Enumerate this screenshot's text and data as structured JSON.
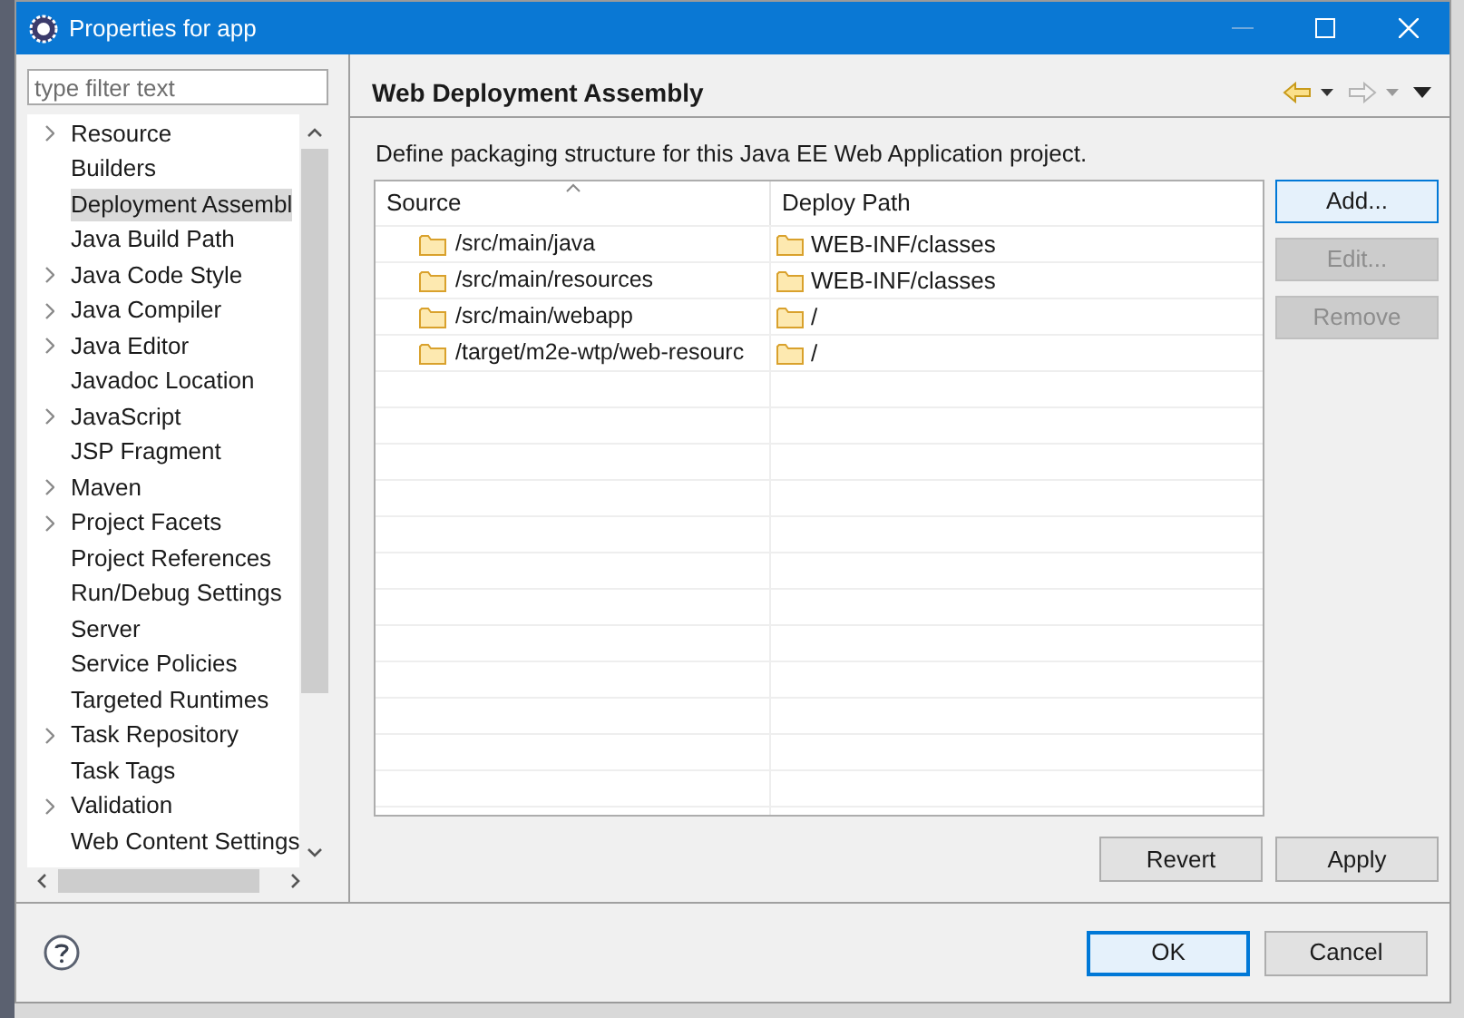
{
  "window": {
    "title": "Properties for app"
  },
  "filter": {
    "placeholder": "type filter text"
  },
  "tree": {
    "items": [
      {
        "label": "Resource",
        "has_children": true,
        "selected": false
      },
      {
        "label": "Builders",
        "has_children": false,
        "selected": false
      },
      {
        "label": "Deployment Assembl",
        "has_children": false,
        "selected": true
      },
      {
        "label": "Java Build Path",
        "has_children": false,
        "selected": false
      },
      {
        "label": "Java Code Style",
        "has_children": true,
        "selected": false
      },
      {
        "label": "Java Compiler",
        "has_children": true,
        "selected": false
      },
      {
        "label": "Java Editor",
        "has_children": true,
        "selected": false
      },
      {
        "label": "Javadoc Location",
        "has_children": false,
        "selected": false
      },
      {
        "label": "JavaScript",
        "has_children": true,
        "selected": false
      },
      {
        "label": "JSP Fragment",
        "has_children": false,
        "selected": false
      },
      {
        "label": "Maven",
        "has_children": true,
        "selected": false
      },
      {
        "label": "Project Facets",
        "has_children": true,
        "selected": false
      },
      {
        "label": "Project References",
        "has_children": false,
        "selected": false
      },
      {
        "label": "Run/Debug Settings",
        "has_children": false,
        "selected": false
      },
      {
        "label": "Server",
        "has_children": false,
        "selected": false
      },
      {
        "label": "Service Policies",
        "has_children": false,
        "selected": false
      },
      {
        "label": "Targeted Runtimes",
        "has_children": false,
        "selected": false
      },
      {
        "label": "Task Repository",
        "has_children": true,
        "selected": false
      },
      {
        "label": "Task Tags",
        "has_children": false,
        "selected": false
      },
      {
        "label": "Validation",
        "has_children": true,
        "selected": false
      },
      {
        "label": "Web Content Settings",
        "has_children": false,
        "selected": false
      }
    ]
  },
  "page": {
    "title": "Web Deployment Assembly",
    "description": "Define packaging structure for this Java EE Web Application project."
  },
  "table": {
    "columns": [
      "Source",
      "Deploy Path"
    ],
    "rows": [
      {
        "source": "/src/main/java",
        "deploy_path": "WEB-INF/classes"
      },
      {
        "source": "/src/main/resources",
        "deploy_path": "WEB-INF/classes"
      },
      {
        "source": "/src/main/webapp",
        "deploy_path": "/"
      },
      {
        "source": "/target/m2e-wtp/web-resourc",
        "deploy_path": "/"
      }
    ]
  },
  "side_buttons": [
    {
      "label": "Add...",
      "disabled": false,
      "focused": true
    },
    {
      "label": "Edit...",
      "disabled": true,
      "focused": false
    },
    {
      "label": "Remove",
      "disabled": true,
      "focused": false
    }
  ],
  "page_buttons": [
    {
      "label": "Revert"
    },
    {
      "label": "Apply"
    }
  ],
  "dialog_buttons": [
    {
      "label": "OK",
      "default": true
    },
    {
      "label": "Cancel",
      "default": false
    }
  ]
}
